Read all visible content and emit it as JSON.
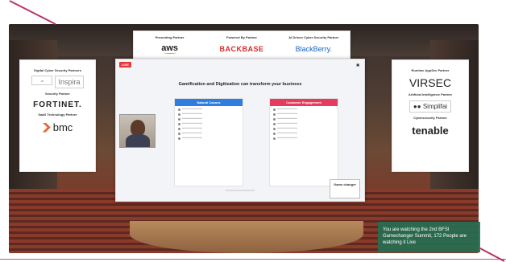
{
  "sponsors_top": {
    "presenting_title": "Presenting Partner",
    "presenting_logo": "aws",
    "powered_title": "Powered By Partner",
    "powered_logo": "BACKBASE",
    "ai_title": "AI Driven Cyber Security Partner",
    "ai_logo": "BlackBerry."
  },
  "left_sponsors": {
    "digital_title": "Digital Cyber Security Partners",
    "digital_logo": "Inspira",
    "security_title": "Security Partner",
    "security_logo": "FORTINET.",
    "saas_title": "SaaS Technology Partner",
    "saas_logo": "bmc"
  },
  "right_sponsors": {
    "runtime_title": "Runtime AppSec Partner",
    "runtime_logo": "VIRSEC",
    "ai_title": "Artificial Intelligence Partner",
    "ai_logo": "Simplifai",
    "cyber_title": "Cybersecurity Partner",
    "cyber_logo": "tenable"
  },
  "slide": {
    "live_badge": "LIVE",
    "title": "Gamification and Digitization can transform your business",
    "left_col_title": "Natural Causes",
    "right_col_title": "Customer Engagement",
    "summit_badge": "Game changer"
  },
  "banner": {
    "text": "You are watching the 2nd BFSI Gamechanger Summit, 172 People are watching it Live"
  },
  "colors": {
    "accent_line": "#b83368",
    "banner_bg": "#266e52"
  }
}
